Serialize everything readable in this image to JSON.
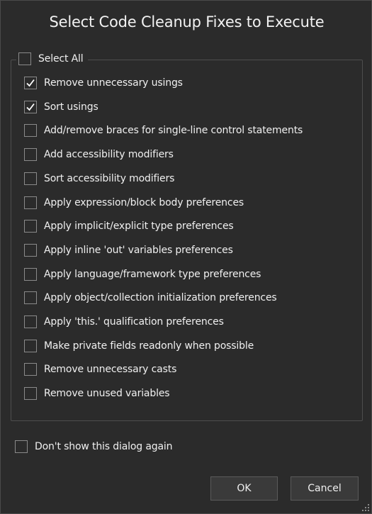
{
  "dialog": {
    "title": "Select Code Cleanup Fixes to Execute"
  },
  "select_all": {
    "label": "Select All",
    "checked": false
  },
  "fixes": [
    {
      "label": "Remove unnecessary usings",
      "checked": true
    },
    {
      "label": "Sort usings",
      "checked": true
    },
    {
      "label": "Add/remove braces for single-line control statements",
      "checked": false
    },
    {
      "label": "Add accessibility modifiers",
      "checked": false
    },
    {
      "label": "Sort accessibility modifiers",
      "checked": false
    },
    {
      "label": "Apply expression/block body preferences",
      "checked": false
    },
    {
      "label": "Apply implicit/explicit type preferences",
      "checked": false
    },
    {
      "label": "Apply inline 'out' variables preferences",
      "checked": false
    },
    {
      "label": "Apply language/framework type preferences",
      "checked": false
    },
    {
      "label": "Apply object/collection initialization preferences",
      "checked": false
    },
    {
      "label": "Apply 'this.' qualification preferences",
      "checked": false
    },
    {
      "label": "Make private fields readonly when possible",
      "checked": false
    },
    {
      "label": "Remove unnecessary casts",
      "checked": false
    },
    {
      "label": "Remove unused variables",
      "checked": false
    }
  ],
  "dont_show": {
    "label": "Don't show this dialog again",
    "checked": false
  },
  "buttons": {
    "ok_label": "OK",
    "cancel_label": "Cancel"
  },
  "colors": {
    "background": "#2b2b2b",
    "text": "#f0f0f0",
    "checkbox_border": "#8a8a8a",
    "button_bg": "#3a3a3a"
  },
  "icons": {
    "check": "checkmark-icon",
    "resize": "resize-grip-icon"
  }
}
